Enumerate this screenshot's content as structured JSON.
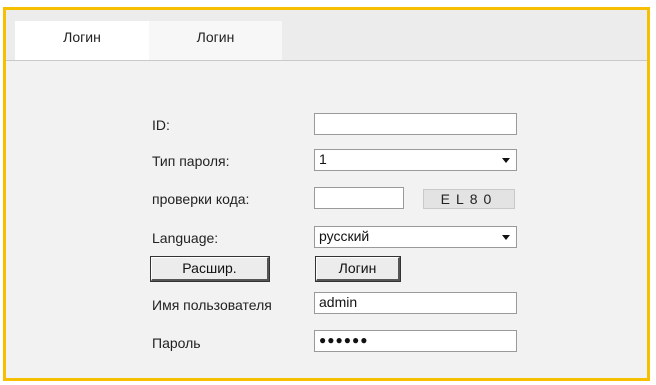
{
  "tabs": [
    {
      "label": "Логин"
    },
    {
      "label": "Логин"
    }
  ],
  "form": {
    "id_label": "ID:",
    "id_value": "",
    "password_type_label": "Тип пароля:",
    "password_type_value": "1",
    "code_label": "проверки кода:",
    "code_value": "",
    "captcha_text": "EL80",
    "language_label": "Language:",
    "language_value": "русский",
    "advanced_button": "Расшир.",
    "login_button": "Логин",
    "username_label": "Имя пользователя",
    "username_value": "admin",
    "password_label": "Пароль",
    "password_masked": "●●●●●●"
  },
  "colors": {
    "frame_border": "#f6c000",
    "panel_bg": "#f2f2f2"
  },
  "icons": {
    "dropdown": "chevron-down-icon"
  }
}
